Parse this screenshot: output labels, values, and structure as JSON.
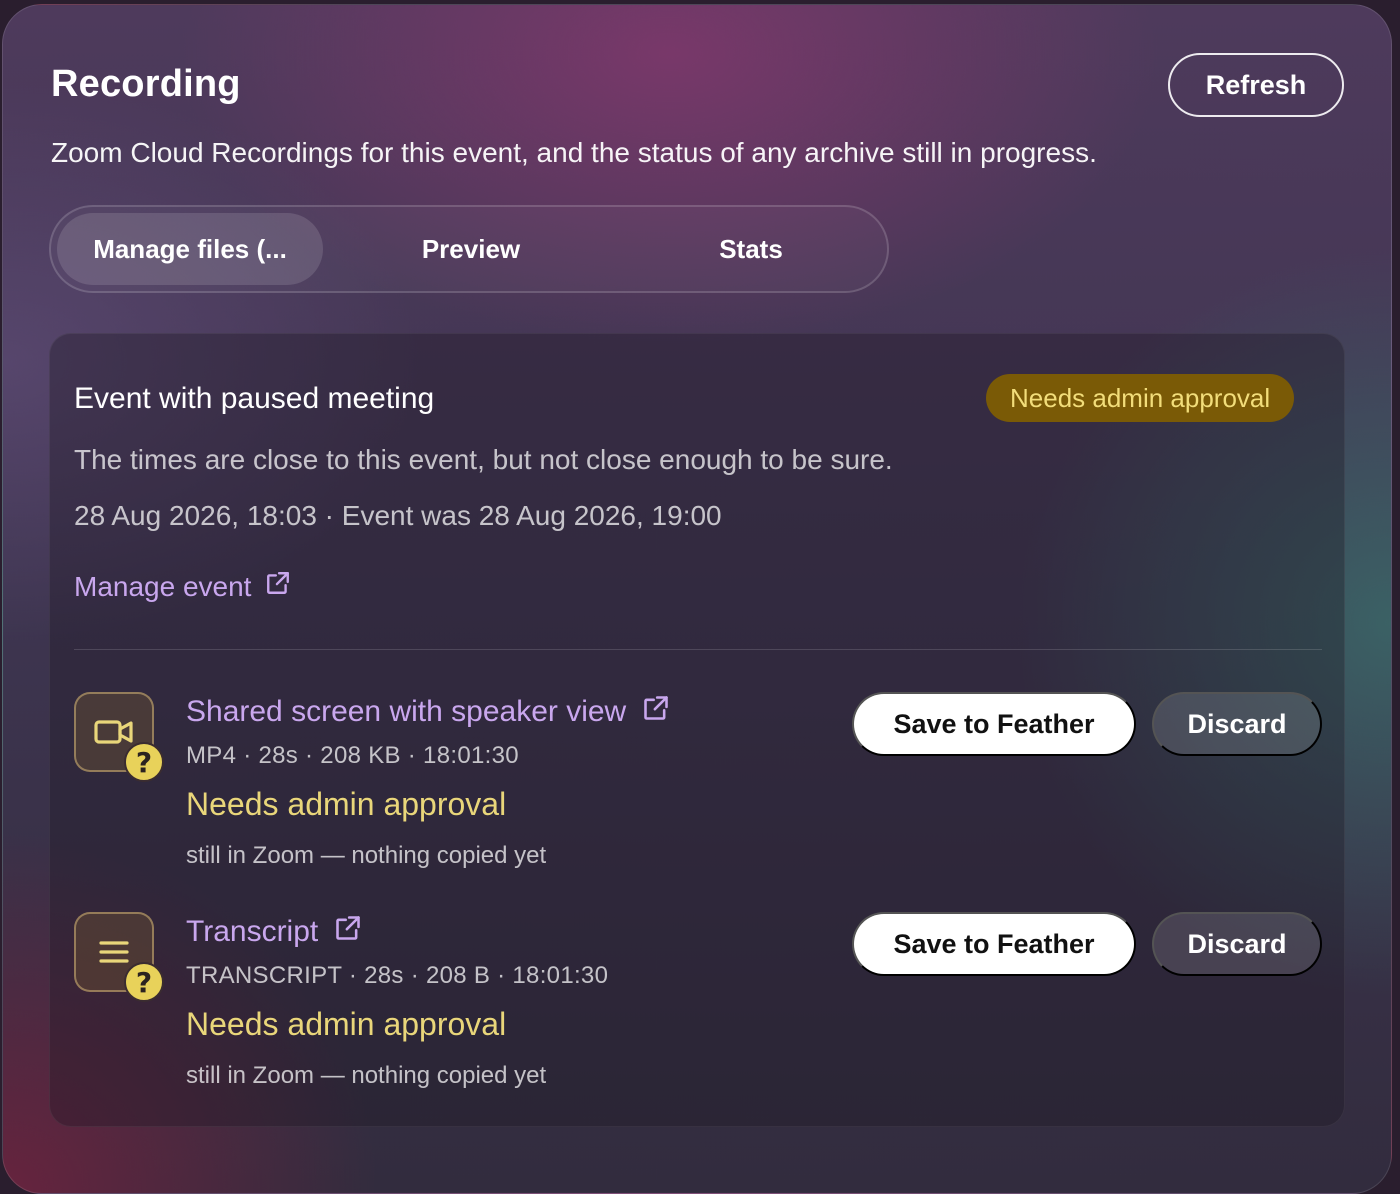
{
  "header": {
    "title": "Recording",
    "refresh_label": "Refresh",
    "subtitle": "Zoom Cloud Recordings for this event, and the status of any archive still in progress."
  },
  "tabs": [
    {
      "label": "Manage files (...",
      "active": true
    },
    {
      "label": "Preview",
      "active": false
    },
    {
      "label": "Stats",
      "active": false
    }
  ],
  "event": {
    "title": "Event with paused meeting",
    "badge": "Needs admin approval",
    "description": "The times are close to this event, but not close enough to be sure.",
    "date_line": "28 Aug 2026, 18:03 · Event was 28 Aug 2026, 19:00",
    "manage_link": "Manage event"
  },
  "files": [
    {
      "icon": "video-camera-icon",
      "name": "Shared screen with speaker view",
      "meta": "MP4 · 28s · 208 KB · 18:01:30",
      "status": "Needs admin approval",
      "note": "still in Zoom — nothing copied yet",
      "save_label": "Save to Feather",
      "discard_label": "Discard"
    },
    {
      "icon": "transcript-lines-icon",
      "name": "Transcript",
      "meta": "TRANSCRIPT · 28s · 208 B · 18:01:30",
      "status": "Needs admin approval",
      "note": "still in Zoom — nothing copied yet",
      "save_label": "Save to Feather",
      "discard_label": "Discard"
    }
  ],
  "colors": {
    "accent_link": "#c9a7ee",
    "warning_text": "#e9d67a",
    "badge_bg": "#7a5a06",
    "badge_text": "#f2dd7a"
  }
}
